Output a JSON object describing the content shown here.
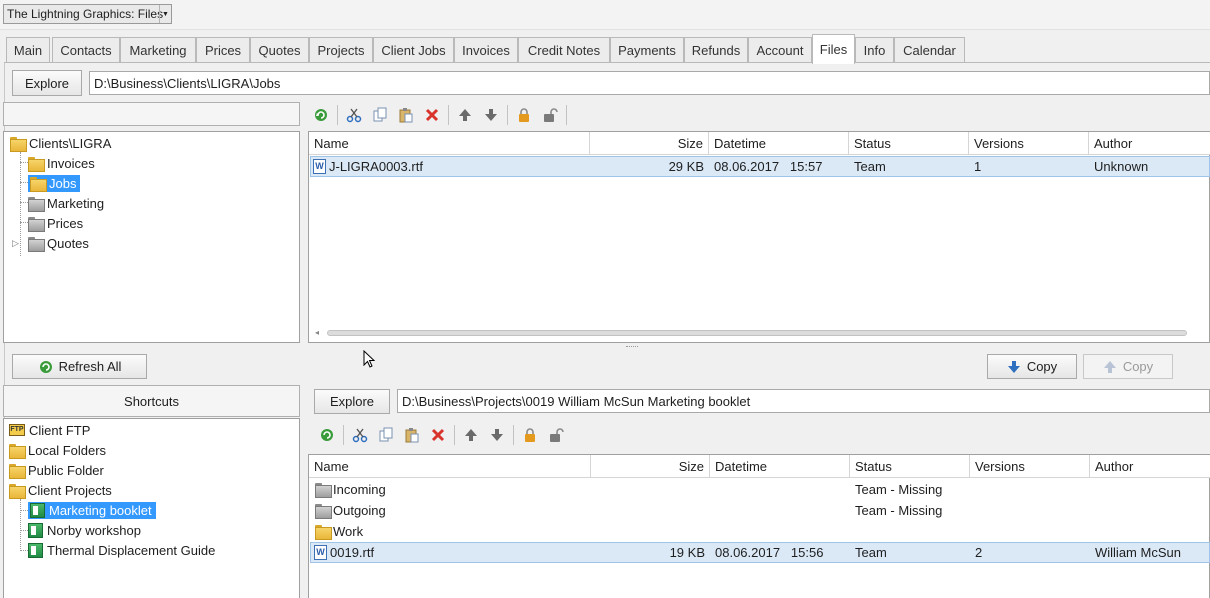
{
  "app": {
    "title": "The Lightning Graphics: Files"
  },
  "tabs": [
    {
      "label": "Main"
    },
    {
      "label": "Contacts"
    },
    {
      "label": "Marketing"
    },
    {
      "label": "Prices"
    },
    {
      "label": "Quotes"
    },
    {
      "label": "Projects"
    },
    {
      "label": "Client Jobs"
    },
    {
      "label": "Invoices"
    },
    {
      "label": "Credit Notes"
    },
    {
      "label": "Payments"
    },
    {
      "label": "Refunds"
    },
    {
      "label": "Account"
    },
    {
      "label": "Files"
    },
    {
      "label": "Info"
    },
    {
      "label": "Calendar"
    }
  ],
  "active_tab": "Files",
  "top": {
    "explore_label": "Explore",
    "path": "D:\\Business\\Clients\\LIGRA\\Jobs",
    "tree": {
      "root": "Clients\\LIGRA",
      "items": [
        {
          "label": "Invoices"
        },
        {
          "label": "Jobs"
        },
        {
          "label": "Marketing"
        },
        {
          "label": "Prices"
        },
        {
          "label": "Quotes"
        }
      ]
    },
    "columns": [
      "Name",
      "Size",
      "Datetime",
      "Status",
      "Versions",
      "Author"
    ],
    "rows": [
      {
        "name": "J-LIGRA0003.rtf",
        "size": "29 KB",
        "datetime": "08.06.2017   15:57",
        "status": "Team",
        "versions": "1",
        "author": "Unknown"
      }
    ]
  },
  "middle": {
    "refresh_all_label": "Refresh All",
    "copy_down_label": "Copy",
    "copy_up_label": "Copy"
  },
  "bottom": {
    "shortcuts_title": "Shortcuts",
    "shortcuts": [
      {
        "label": "Client FTP"
      },
      {
        "label": "Local Folders"
      },
      {
        "label": "Public Folder"
      },
      {
        "label": "Client Projects"
      },
      {
        "label": "Marketing booklet"
      },
      {
        "label": "Norby workshop"
      },
      {
        "label": "Thermal Displacement Guide"
      }
    ],
    "explore_label": "Explore",
    "path": "D:\\Business\\Projects\\0019 William McSun Marketing booklet",
    "columns": [
      "Name",
      "Size",
      "Datetime",
      "Status",
      "Versions",
      "Author"
    ],
    "rows": [
      {
        "name": "Incoming",
        "size": "",
        "datetime": "",
        "status": "Team - Missing",
        "versions": "",
        "author": ""
      },
      {
        "name": "Outgoing",
        "size": "",
        "datetime": "",
        "status": "Team - Missing",
        "versions": "",
        "author": ""
      },
      {
        "name": "Work",
        "size": "",
        "datetime": "",
        "status": "",
        "versions": "",
        "author": ""
      },
      {
        "name": "0019.rtf",
        "size": "19 KB",
        "datetime": "08.06.2017   15:56",
        "status": "Team",
        "versions": "2",
        "author": "William McSun"
      }
    ]
  },
  "colors": {
    "selection": "#3399ff",
    "row_highlight": "#dbe9f7",
    "delete_red": "#d9342b",
    "refresh_green": "#3a9b3a",
    "arrow_blue": "#2f6fc0",
    "lock_orange": "#e39a1f"
  }
}
